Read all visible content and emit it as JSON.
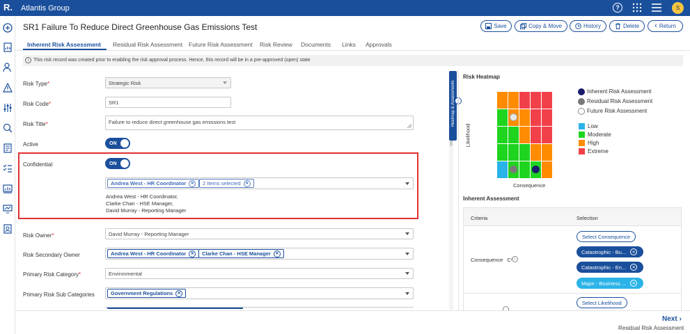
{
  "header": {
    "logo": "R.",
    "org_name": "Atlantis Group",
    "avatar_initial": "S"
  },
  "record": {
    "title": "SR1 Failure To Reduce Direct Greenhouse Gas Emissions Test"
  },
  "toolbar": {
    "save": "Save",
    "copy_move": "Copy & Move",
    "history": "History",
    "delete": "Delete",
    "return": "Return"
  },
  "tabs": [
    "Inherent Risk Assessment",
    "Residual Risk Assessment",
    "Future Risk Assessment",
    "Risk Review",
    "Documents",
    "Links",
    "Approvals"
  ],
  "notice": "This risk record was created prior to enabling the risk approval process. Hence, this record will be in a pre-approved (open) state",
  "form": {
    "risk_type": {
      "label": "Risk Type",
      "value": "Strategic Risk"
    },
    "risk_code": {
      "label": "Risk Code",
      "value": "SR1"
    },
    "risk_title": {
      "label": "Risk Title",
      "value": "Failure to reduce direct greenhouse gas emissions test"
    },
    "active": {
      "label": "Active",
      "value": "ON"
    },
    "confidential": {
      "label": "Confidential",
      "value": "ON",
      "chip1": "Andrea West - HR Coordinator",
      "chip2": "2 Items selected",
      "selected_list": [
        "Andrea West - HR Coordinator,",
        "Clarke Chan - HSE Manager,",
        "David Murray - Reporting Manager"
      ]
    },
    "risk_owner": {
      "label": "Risk Owner",
      "value": "David Murray - Reporting Manager"
    },
    "risk_secondary_owner": {
      "label": "Risk Secondary Owner",
      "chips": [
        "Andrea West - HR Coordinator",
        "Clarke Chan - HSE Manager"
      ]
    },
    "primary_risk_category": {
      "label": "Primary Risk Category",
      "value": "Environmental"
    },
    "primary_risk_sub_categories": {
      "label": "Primary Risk Sub Categories",
      "chips": [
        "Government Regulations"
      ]
    }
  },
  "side_tab": "Heatmap & Assessments",
  "heatmap": {
    "title": "Risk Heatmap",
    "y_label": "Likelihood",
    "x_label": "Consequence",
    "grid": [
      [
        "high",
        "high",
        "extreme",
        "extreme",
        "extreme"
      ],
      [
        "moderate",
        "high",
        "high",
        "extreme",
        "extreme"
      ],
      [
        "moderate",
        "moderate",
        "high",
        "extreme",
        "extreme"
      ],
      [
        "moderate",
        "moderate",
        "moderate",
        "high",
        "high"
      ],
      [
        "low",
        "moderate",
        "moderate",
        "moderate",
        "high"
      ]
    ],
    "markers": [
      {
        "type": "future",
        "row": 1,
        "col": 1
      },
      {
        "type": "residual",
        "row": 4,
        "col": 1
      },
      {
        "type": "inherent",
        "row": 4,
        "col": 3
      }
    ],
    "marker_legend": [
      "Inherent Risk Assessment",
      "Residual Risk Assessment",
      "Future Risk Assessment"
    ],
    "level_legend": [
      "Low",
      "Moderate",
      "High",
      "Extreme"
    ],
    "colors": {
      "low": "#2ab3e8",
      "moderate": "#1fd41f",
      "high": "#ff8c00",
      "extreme": "#f2404a",
      "inherent": "#1c1c6e",
      "residual": "#7a7a7a",
      "future": "#e8e8e8",
      "brand": "#1a4f9c"
    }
  },
  "assessment": {
    "title": "Inherent Assessment",
    "col_criteria": "Criteria",
    "col_selection": "Selection",
    "consequence_label": "Consequence",
    "consequence_suffix": "C*",
    "select_consequence": "Select Consequence",
    "pills": [
      "Catastrophic - Bu...",
      "Catastrophic - En...",
      "Major - Business ..."
    ],
    "select_likelihood": "Select Likelihood"
  },
  "footer": {
    "next": "Next",
    "next_sub": "Residual Risk Assessment"
  }
}
